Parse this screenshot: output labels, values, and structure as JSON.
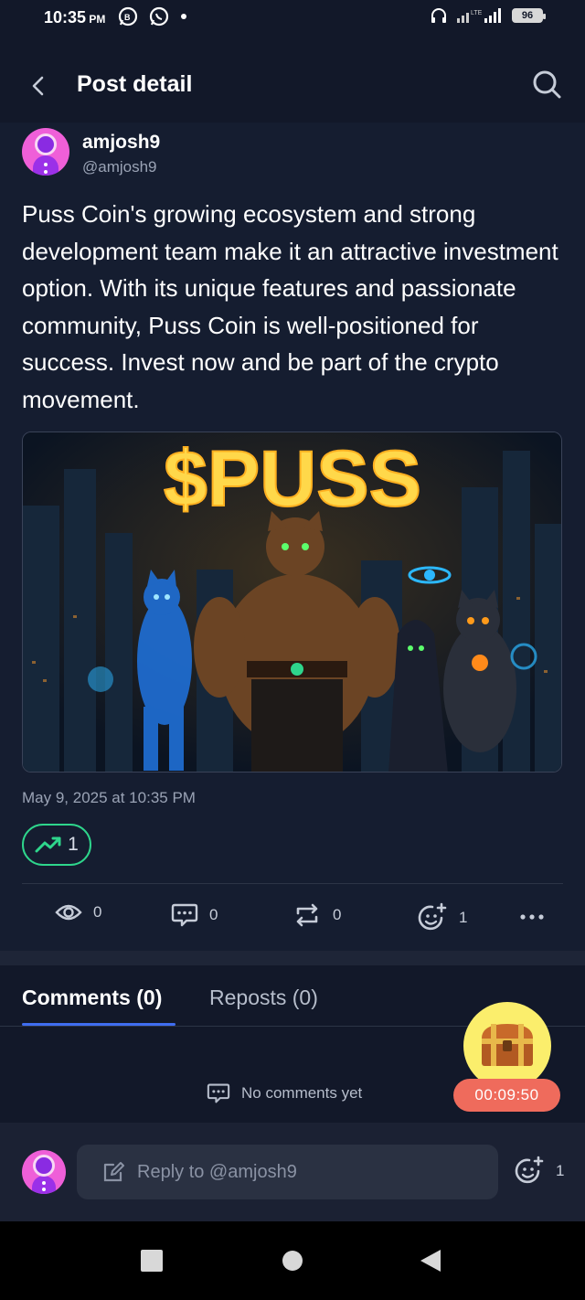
{
  "status_bar": {
    "time": "10:35",
    "ampm": "PM",
    "network": "LTE",
    "battery": "96"
  },
  "header": {
    "title": "Post detail"
  },
  "post": {
    "author_name": "amjosh9",
    "author_handle": "@amjosh9",
    "text": "Puss Coin's growing ecosystem and strong development team make it an attractive investment option. With its unique features and passionate community, Puss Coin is well-positioned for success. Invest now and be part of the crypto movement.",
    "image_text": "$PUSS",
    "date": "May 9, 2025 at 10:35 PM",
    "trend_count": "1",
    "stats": {
      "views": "0",
      "comments": "0",
      "reposts": "0",
      "reactions": "1"
    }
  },
  "comments_section": {
    "tabs": [
      {
        "label": "Comments (0)",
        "active": true
      },
      {
        "label": "Reposts (0)",
        "active": false
      }
    ],
    "empty_text": "No comments yet"
  },
  "reward": {
    "timer": "00:09:50"
  },
  "reply": {
    "placeholder": "Reply to @amjosh9",
    "reaction_count": "1"
  },
  "colors": {
    "background": "#121829",
    "post_background": "#151d30",
    "accent_green": "#2ed68c",
    "accent_blue": "#3f6df0",
    "timer_red": "#ef6b5c",
    "treasure_yellow": "#fbee6c"
  }
}
